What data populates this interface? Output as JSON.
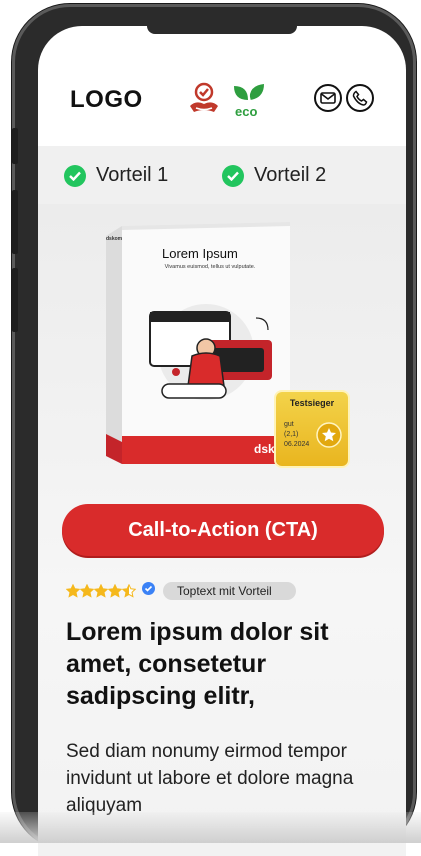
{
  "header": {
    "logo": "LOGO",
    "trust_icons": [
      "handshake-badge-icon",
      "eco-leaf-icon"
    ],
    "eco_label": "eco",
    "contact_icons": [
      "mail-icon",
      "phone-icon"
    ]
  },
  "benefits": [
    {
      "label": "Vorteil 1",
      "icon": "check-circle-icon"
    },
    {
      "label": "Vorteil 2",
      "icon": "check-circle-icon"
    }
  ],
  "product": {
    "box_title": "Lorem Ipsum",
    "box_subtitle": "Vivamus euismod, tellus ut vulputate.",
    "box_side_label": "dskom",
    "box_brand": "dskom",
    "award": {
      "title": "Testsieger",
      "rating_word": "gut",
      "score": "(2,1)",
      "date": "06.2024"
    }
  },
  "cta": {
    "label": "Call-to-Action (CTA)"
  },
  "rating": {
    "stars": 4.5,
    "badge": "Toptext mit Vorteil"
  },
  "headline": "Lorem ipsum dolor sit amet, consetetur sadipscing elitr,",
  "body": "Sed diam nonumy eirmod tempor invidunt ut labore et dolore magna aliquyam",
  "colors": {
    "cta": "#d92b2b",
    "check": "#22c55e",
    "star": "#f5b81c",
    "verified": "#3b82f6",
    "eco": "#2e9e3f",
    "award": "#f0c93a"
  }
}
